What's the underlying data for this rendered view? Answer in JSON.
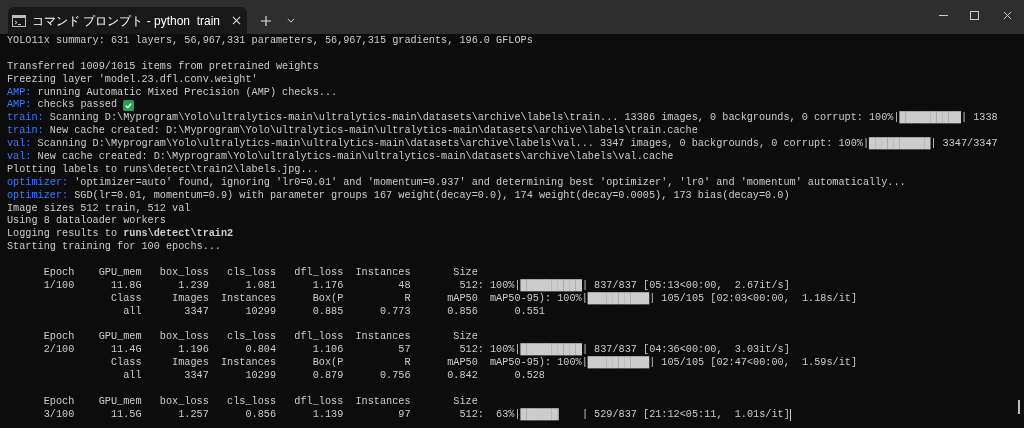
{
  "window": {
    "tab_title": "コマンド プロンプト - python  train"
  },
  "lines": [
    {
      "kind": "text",
      "segments": [
        {
          "kind": "text",
          "text": "YOLO11x summary: 631 layers, 56,967,331 parameters, 56,967,315 gradients, 196.0 GFLOPs"
        }
      ]
    },
    {
      "kind": "blank"
    },
    {
      "kind": "text",
      "segments": [
        {
          "kind": "text",
          "text": "Transferred 1009/1015 items from pretrained weights"
        }
      ]
    },
    {
      "kind": "text",
      "segments": [
        {
          "kind": "text",
          "text": "Freezing layer 'model.23.dfl.conv.weight'"
        }
      ]
    },
    {
      "kind": "text",
      "segments": [
        {
          "kind": "prefix",
          "text": "AMP:"
        },
        {
          "kind": "text",
          "text": " running Automatic Mixed Precision (AMP) checks..."
        }
      ]
    },
    {
      "kind": "text",
      "segments": [
        {
          "kind": "prefix",
          "text": "AMP:"
        },
        {
          "kind": "text",
          "text": " checks passed "
        },
        {
          "kind": "check"
        }
      ]
    },
    {
      "kind": "text",
      "segments": [
        {
          "kind": "prefix",
          "text": "train:"
        },
        {
          "kind": "text",
          "text": " Scanning D:\\Myprogram\\Yolo\\ultralytics-main\\ultralytics-main\\datasets\\archive\\labels\\train... 13386 images, 0 backgrounds, 0 corrupt: 100%|"
        },
        {
          "kind": "bar",
          "text": "██████████"
        },
        {
          "kind": "text",
          "text": "| 1338"
        }
      ]
    },
    {
      "kind": "text",
      "segments": [
        {
          "kind": "prefix",
          "text": "train:"
        },
        {
          "kind": "text",
          "text": " New cache created: D:\\Myprogram\\Yolo\\ultralytics-main\\ultralytics-main\\datasets\\archive\\labels\\train.cache"
        }
      ]
    },
    {
      "kind": "text",
      "segments": [
        {
          "kind": "prefix",
          "text": "val:"
        },
        {
          "kind": "text",
          "text": " Scanning D:\\Myprogram\\Yolo\\ultralytics-main\\ultralytics-main\\datasets\\archive\\labels\\val... 3347 images, 0 backgrounds, 0 corrupt: 100%|"
        },
        {
          "kind": "bar",
          "text": "██████████"
        },
        {
          "kind": "text",
          "text": "| 3347/3347"
        }
      ]
    },
    {
      "kind": "text",
      "segments": [
        {
          "kind": "prefix",
          "text": "val:"
        },
        {
          "kind": "text",
          "text": " New cache created: D:\\Myprogram\\Yolo\\ultralytics-main\\ultralytics-main\\datasets\\archive\\labels\\val.cache"
        }
      ]
    },
    {
      "kind": "text",
      "segments": [
        {
          "kind": "text",
          "text": "Plotting labels to runs\\detect\\train2\\labels.jpg..."
        }
      ]
    },
    {
      "kind": "text",
      "segments": [
        {
          "kind": "prefix",
          "text": "optimizer:"
        },
        {
          "kind": "text",
          "text": " 'optimizer=auto' found, ignoring 'lr0=0.01' and 'momentum=0.937' and determining best 'optimizer', 'lr0' and 'momentum' automatically..."
        }
      ]
    },
    {
      "kind": "text",
      "segments": [
        {
          "kind": "prefix",
          "text": "optimizer:"
        },
        {
          "kind": "text",
          "text": " SGD(lr=0.01, momentum=0.9) with parameter groups 167 weight(decay=0.0), 174 weight(decay=0.0005), 173 bias(decay=0.0)"
        }
      ]
    },
    {
      "kind": "text",
      "segments": [
        {
          "kind": "text",
          "text": "Image sizes 512 train, 512 val"
        }
      ]
    },
    {
      "kind": "text",
      "segments": [
        {
          "kind": "text",
          "text": "Using 8 dataloader workers"
        }
      ]
    },
    {
      "kind": "text",
      "segments": [
        {
          "kind": "text",
          "text": "Logging results to **runs\\detect\\train2**"
        }
      ]
    },
    {
      "kind": "text",
      "segments": [
        {
          "kind": "text",
          "text": "Starting training for 100 epochs..."
        }
      ]
    },
    {
      "kind": "blank"
    },
    {
      "kind": "text",
      "segments": [
        {
          "kind": "text",
          "text": "      Epoch    GPU_mem   box_loss   cls_loss   dfl_loss  Instances       Size"
        }
      ]
    },
    {
      "kind": "text",
      "segments": [
        {
          "kind": "text",
          "text": "      1/100      11.8G      1.239      1.081      1.176         48        512: 100%|"
        },
        {
          "kind": "bar",
          "text": "██████████"
        },
        {
          "kind": "text",
          "text": "| 837/837 [05:13<00:00,  2.67it/s]"
        }
      ]
    },
    {
      "kind": "text",
      "segments": [
        {
          "kind": "text",
          "text": "                 Class     Images  Instances      Box(P          R      mAP50  mAP50-95): 100%|"
        },
        {
          "kind": "bar",
          "text": "██████████"
        },
        {
          "kind": "text",
          "text": "| 105/105 [02:03<00:00,  1.18s/it]"
        }
      ]
    },
    {
      "kind": "text",
      "segments": [
        {
          "kind": "text",
          "text": "                   all       3347      10299      0.885      0.773      0.856      0.551"
        }
      ]
    },
    {
      "kind": "blank"
    },
    {
      "kind": "text",
      "segments": [
        {
          "kind": "text",
          "text": "      Epoch    GPU_mem   box_loss   cls_loss   dfl_loss  Instances       Size"
        }
      ]
    },
    {
      "kind": "text",
      "segments": [
        {
          "kind": "text",
          "text": "      2/100      11.4G      1.196      0.804      1.106         57        512: 100%|"
        },
        {
          "kind": "bar",
          "text": "██████████"
        },
        {
          "kind": "text",
          "text": "| 837/837 [04:36<00:00,  3.03it/s]"
        }
      ]
    },
    {
      "kind": "text",
      "segments": [
        {
          "kind": "text",
          "text": "                 Class     Images  Instances      Box(P          R      mAP50  mAP50-95): 100%|"
        },
        {
          "kind": "bar",
          "text": "██████████"
        },
        {
          "kind": "text",
          "text": "| 105/105 [02:47<00:00,  1.59s/it]"
        }
      ]
    },
    {
      "kind": "text",
      "segments": [
        {
          "kind": "text",
          "text": "                   all       3347      10299      0.879      0.756      0.842      0.528"
        }
      ]
    },
    {
      "kind": "blank"
    },
    {
      "kind": "text",
      "segments": [
        {
          "kind": "text",
          "text": "      Epoch    GPU_mem   box_loss   cls_loss   dfl_loss  Instances       Size"
        }
      ]
    },
    {
      "kind": "text",
      "segments": [
        {
          "kind": "text",
          "text": "      3/100      11.5G      1.257      0.856      1.139         97        512:  63%|"
        },
        {
          "kind": "bar",
          "text": "██████▎   "
        },
        {
          "kind": "text",
          "text": "| 529/837 [21:12<05:11,  1.01s/it]"
        },
        {
          "kind": "cursor"
        }
      ]
    }
  ]
}
